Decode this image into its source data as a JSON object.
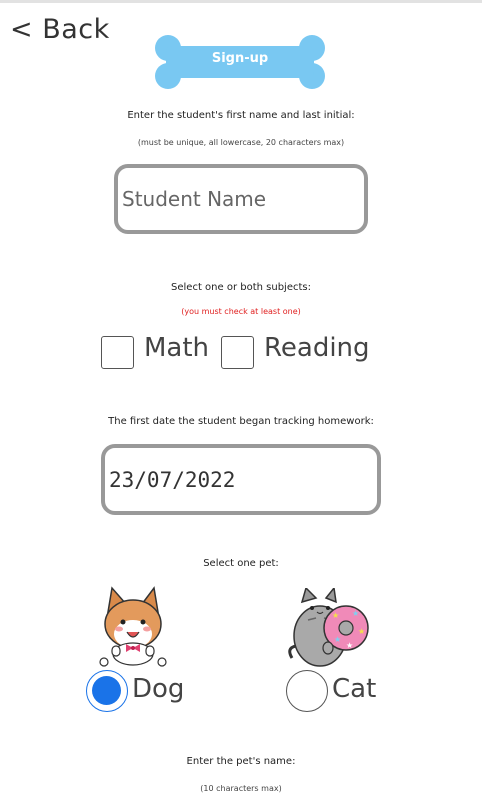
{
  "nav": {
    "back_label": "< Back"
  },
  "header": {
    "title": "Sign-up",
    "bone_color": "#79c8f2"
  },
  "student": {
    "prompt": "Enter the student's first name and last initial:",
    "hint": "(must be unique, all lowercase, 20 characters max)",
    "placeholder": "Student Name",
    "value": ""
  },
  "subjects": {
    "prompt": "Select one or both subjects:",
    "hint": "(you must check at least one)",
    "hint_color": "#e02020",
    "options": [
      {
        "label": "Math",
        "checked": false
      },
      {
        "label": "Reading",
        "checked": false
      }
    ]
  },
  "tracking": {
    "prompt": "The first date the student began tracking homework:",
    "date_value": "23/07/2022"
  },
  "pet": {
    "prompt": "Select one pet:",
    "options": [
      {
        "label": "Dog",
        "icon": "shiba-dog-icon",
        "selected": true
      },
      {
        "label": "Cat",
        "icon": "pusheen-cat-donut-icon",
        "selected": false
      }
    ],
    "accent_color": "#1a73e8"
  },
  "pet_name": {
    "prompt": "Enter the pet's name:",
    "hint": "(10 characters max)"
  }
}
